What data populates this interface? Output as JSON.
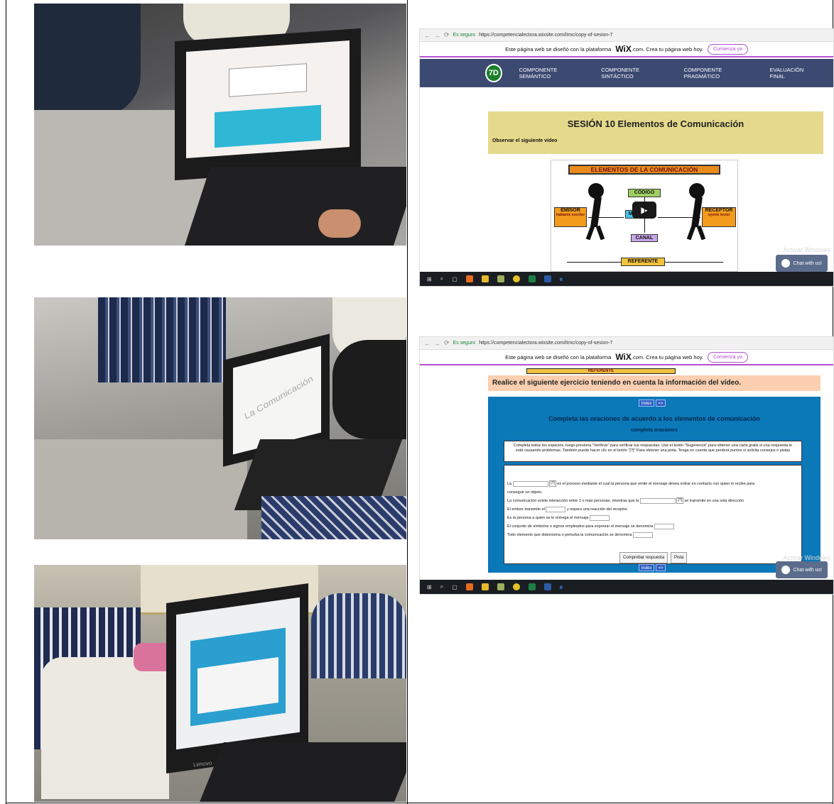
{
  "screenshot_1": {
    "url": "https://competencialectora.wixsite.com/itmc/copy-of-sesion-7",
    "secure_label": "Es seguro",
    "wix_notice": "Este página web se diseñó con la plataforma",
    "wix_brand": "WiX",
    "wix_notice_end": ".com. Crea tu página web hoy.",
    "wix_cta": "Comienza ya",
    "logo_text": "7D",
    "nav": [
      "COMPONENTE SEMÁNTICO",
      "COMPONENTE SINTÁCTICO",
      "COMPONENTE PRAGMÁTICO",
      "EVALUACIÓN FINAL"
    ],
    "session_title": "SESIÓN 10  Elementos de Comunicación",
    "session_subtitle": "Observar el siguiente video",
    "video": {
      "banner": "ELEMENTOS DE LA COMUNICACIÓN",
      "codigo": "CÓDIGO",
      "emisor": "EMISOR",
      "emisor_sub": "hablante escritor",
      "receptor": "RECEPTOR",
      "receptor_sub": "oyente lector",
      "mensaje": "ME",
      "canal": "CANAL",
      "referente": "REFERENTE"
    },
    "activar": "Activar Windows",
    "chat": "Chat with us!"
  },
  "screenshot_2": {
    "url": "https://competencialectora.wixsite.com/itmc/copy-of-sesion-7",
    "secure_label": "Es seguro",
    "wix_notice": "Este página web se diseñó con la plataforma",
    "wix_brand": "WiX",
    "wix_notice_end": ".com. Crea tu página web hoy.",
    "wix_cta": "Comienza ya",
    "torn_label": "REFERENTE",
    "exercise_header": "Realice el siguiente ejercicio teniendo en cuenta la información del vídeo.",
    "index_btn": "Index",
    "next_btn": "=>",
    "title": "Completa las oraciones de acuerdo a los elementos de comunicación",
    "subtitle": "completa oraciones",
    "instructions": "Completa todos los espacios, luego presiona \"Verificar\" para verificar tus respuestas. Use el botón \"Sugerencia\" para obtener una carta gratis si una respuesta le está causando problemas. También puede hacer clic en el botón \"[?]\" Para obtener una pista. Tenga en cuenta que perderá puntos si solicita consejos o pistas",
    "q_mark": "[?]",
    "lines": {
      "l1_a": "La",
      "l1_b": "es el proceso mediante el cual la persona que emite el mensaje desea entrar en contacto con quien lo recibe para",
      "l1_c": "conseguir un objeto.",
      "l2_a": "La comunicación existe interacción entre 2 o más personas, mientras que la",
      "l2_b": "se transmite en una sola dirección",
      "l3_a": "El emisor transmite el",
      "l3_b": "y espera una reacción del receptor.",
      "l4": "Es la persona a quien se le entrega el mensaje",
      "l5": "El conjunto de símbolos o signos empleados para expresar el mensaje se denomina",
      "l6": "Todo elemento que distorsiona o perturba la comunicación se denomina"
    },
    "check_btn": "Comprobar respuesta",
    "hint_btn": "Pista",
    "activar": "Activar Windows",
    "chat": "Chat with us!"
  },
  "photo_1": {
    "screen_accent": "#2eb8d6"
  },
  "photo_2": {
    "screen_text": "La Comunicación"
  },
  "photo_3": {
    "brand": "Lenovo"
  }
}
